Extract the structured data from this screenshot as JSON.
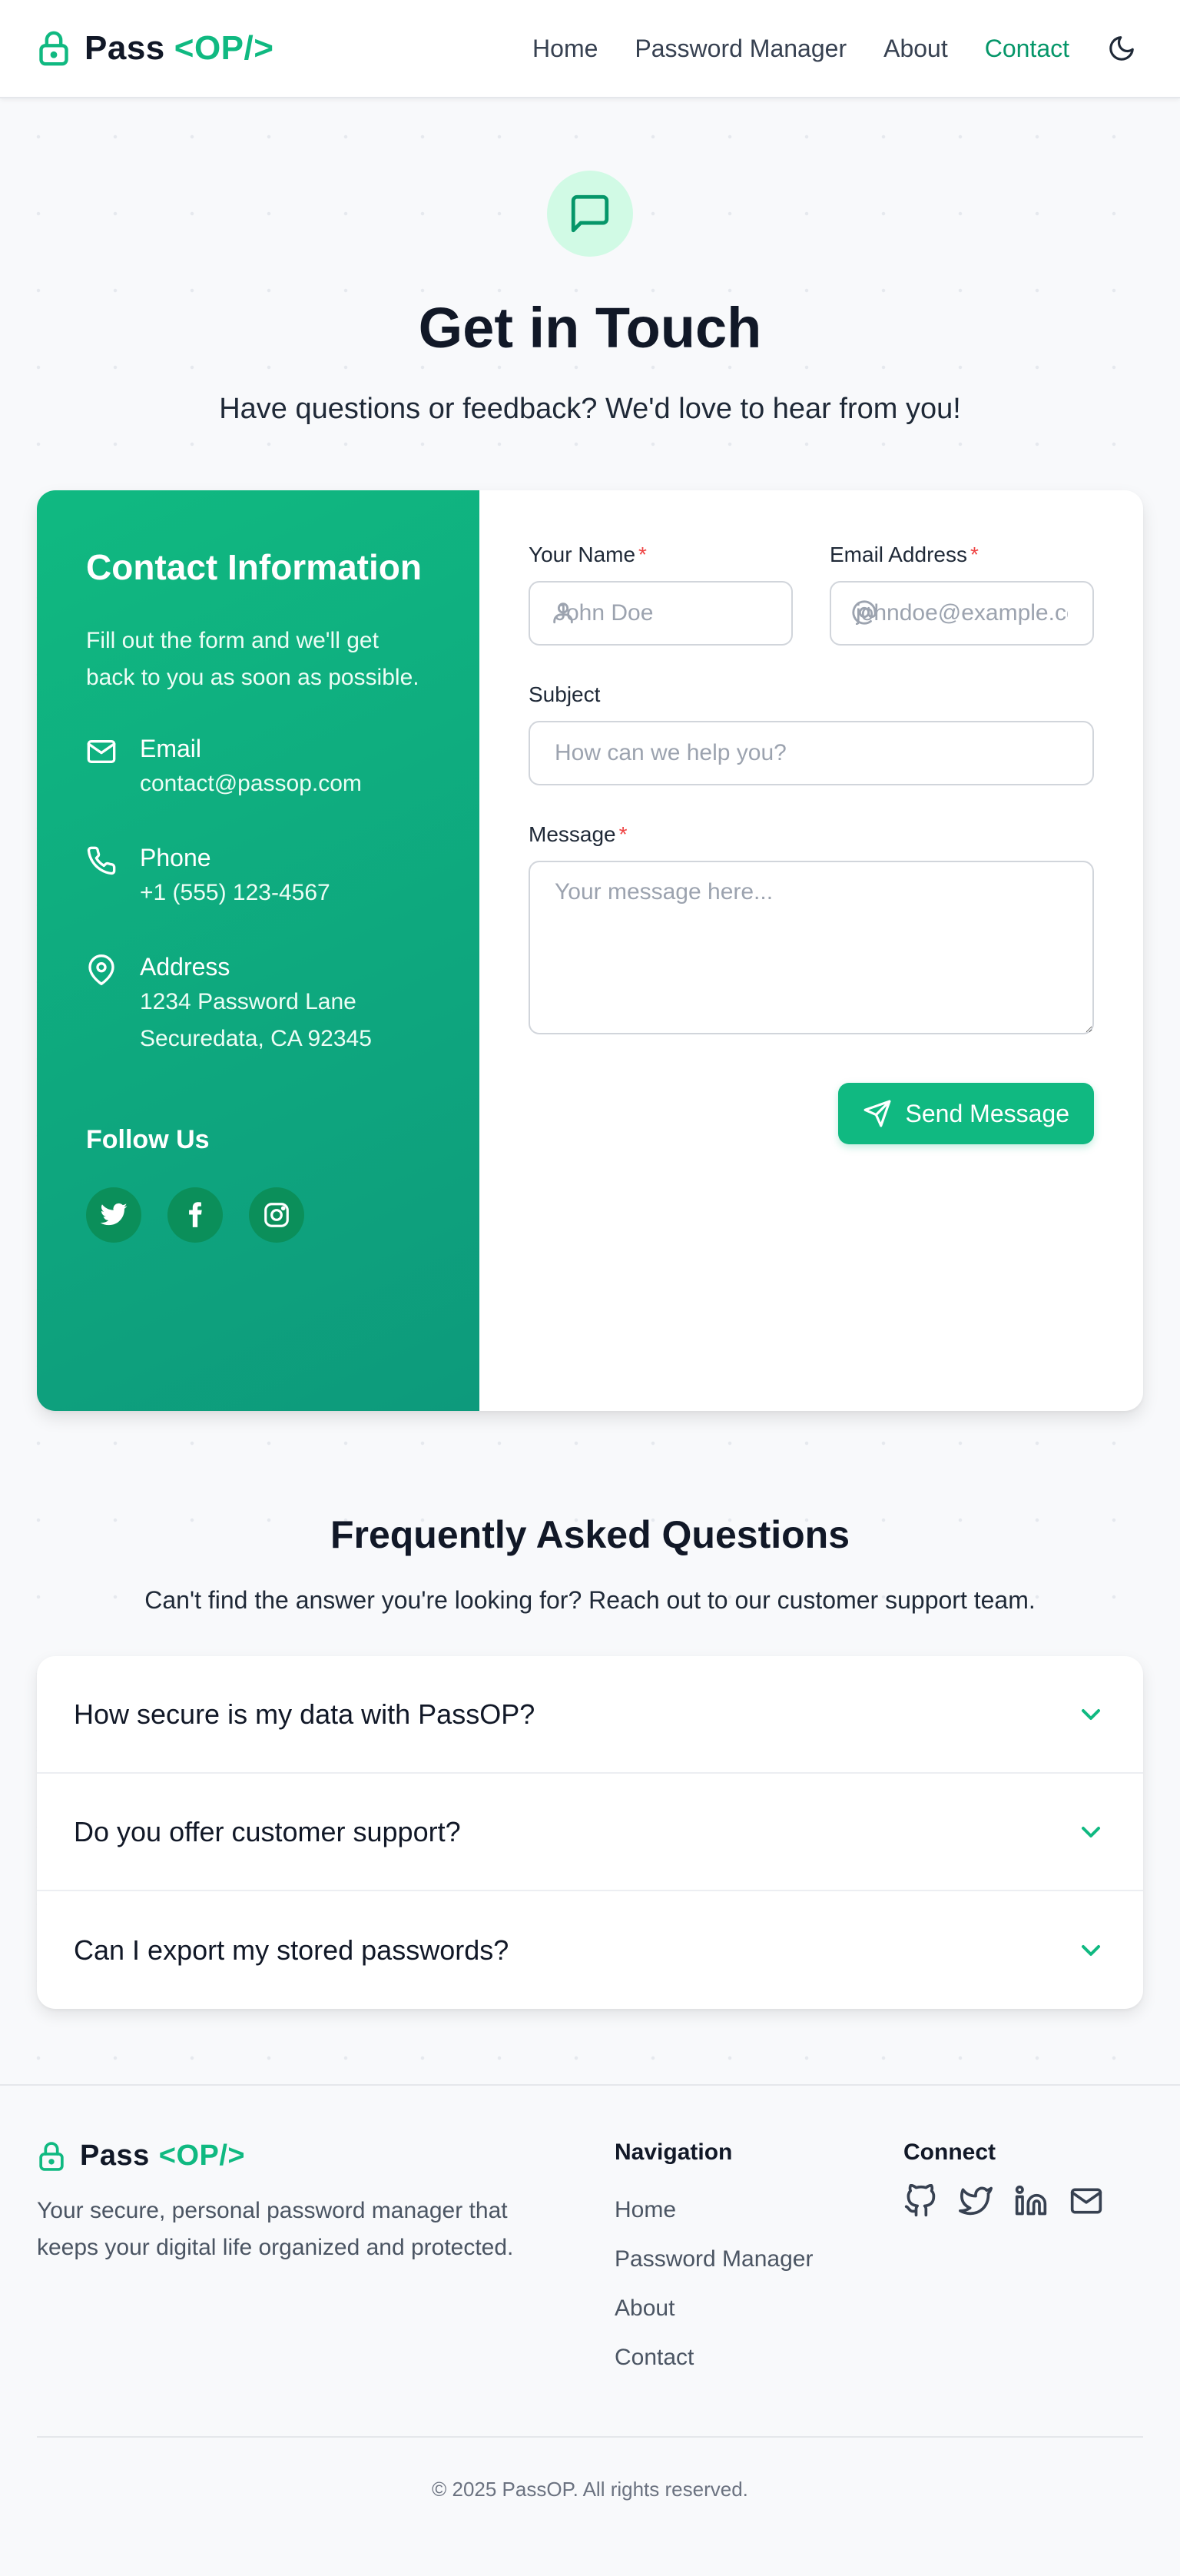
{
  "brand": {
    "name": "Pass",
    "accent": "<OP/>"
  },
  "nav": {
    "links": [
      {
        "label": "Home"
      },
      {
        "label": "Password Manager"
      },
      {
        "label": "About"
      },
      {
        "label": "Contact"
      }
    ],
    "active": "Contact"
  },
  "hero": {
    "title": "Get in Touch",
    "subtitle": "Have questions or feedback? We'd love to hear from you!",
    "icon": "message-square-icon"
  },
  "contact_info": {
    "title": "Contact Information",
    "description": "Fill out the form and we'll get back to you as soon as possible.",
    "email": {
      "label": "Email",
      "value": "contact@passop.com"
    },
    "phone": {
      "label": "Phone",
      "value": "+1 (555) 123-4567"
    },
    "address": {
      "label": "Address",
      "line1": "1234 Password Lane",
      "line2": "Securedata, CA 92345"
    },
    "follow_title": "Follow Us",
    "socials": [
      "twitter-icon",
      "facebook-icon",
      "instagram-icon"
    ]
  },
  "form": {
    "name": {
      "label": "Your Name",
      "required": "*",
      "placeholder": "John Doe",
      "value": ""
    },
    "email": {
      "label": "Email Address",
      "required": "*",
      "placeholder": "johndoe@example.com",
      "value": ""
    },
    "subject": {
      "label": "Subject",
      "placeholder": "How can we help you?",
      "value": ""
    },
    "message": {
      "label": "Message",
      "required": "*",
      "placeholder": "Your message here...",
      "value": ""
    },
    "submit_label": "Send Message"
  },
  "faq": {
    "title": "Frequently Asked Questions",
    "subtitle": "Can't find the answer you're looking for? Reach out to our customer support team.",
    "items": [
      {
        "question": "How secure is my data with PassOP?"
      },
      {
        "question": "Do you offer customer support?"
      },
      {
        "question": "Can I export my stored passwords?"
      }
    ]
  },
  "footer": {
    "brand": {
      "name": "Pass",
      "accent": "<OP/>"
    },
    "description": "Your secure, personal password manager that keeps your digital life organized and protected.",
    "navigation": {
      "title": "Navigation",
      "links": [
        "Home",
        "Password Manager",
        "About",
        "Contact"
      ]
    },
    "connect": {
      "title": "Connect",
      "icons": [
        "github-icon",
        "twitter-icon",
        "linkedin-icon",
        "mail-icon"
      ]
    },
    "copyright": "© 2025 PassOP. All rights reserved."
  },
  "colors": {
    "accent": "#10b981",
    "accent_dark": "#059669",
    "text": "#111827",
    "muted": "#4b5563",
    "required": "#ef4444"
  }
}
